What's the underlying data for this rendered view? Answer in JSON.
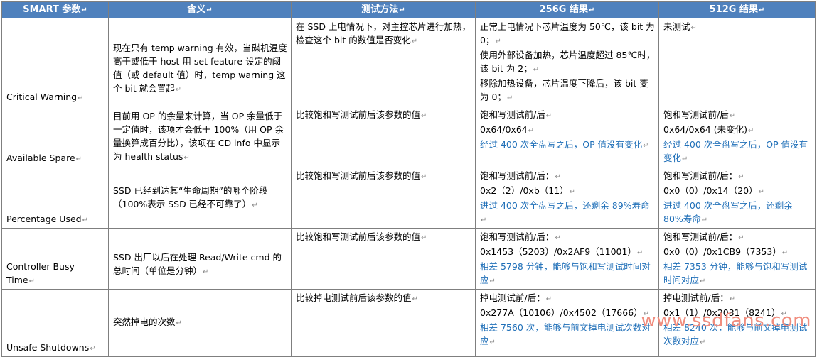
{
  "table": {
    "headers": [
      "SMART 参数",
      "含义",
      "测试方法",
      "256G 结果",
      "512G 结果"
    ],
    "rows": [
      {
        "param": "Critical Warning",
        "meaning": "现在只有 temp warning 有效，当碟机温度高于或低于 host 用 set feature 设定的阈值（或 default 值）时，temp warning 这个 bit 就会置起",
        "method": "在 SSD 上电情况下，对主控芯片进行加热，检查这个 bit 的数值是否变化",
        "r256": [
          "正常上电情况下芯片温度为 50℃，该 bit 为 0；",
          "使用外部设备加热，芯片温度超过 85℃时，该 bit 为 2；",
          "移除加热设备，芯片温度下降后，该 bit 变为 0；"
        ],
        "r256_note": "",
        "r512": [
          "未测试"
        ],
        "r512_note": ""
      },
      {
        "param": "Available Spare",
        "meaning": "目前用 OP 的余量来计算，当 OP 余量低于一定值时，该项才会低于 100%（用 OP 余量换算成百分比），该项在 CD info 中显示为 health status",
        "method": "比较饱和写测试前后该参数的值",
        "r256": [
          "饱和写测试前/后",
          "0x64/0x64"
        ],
        "r256_note": "经过 400 次全盘写之后，OP 值没有变化",
        "r512": [
          "饱和写测试前/后",
          "0x64/0x64 (未变化)"
        ],
        "r512_note": "经过 400 次全盘写之后，OP 值没有变化"
      },
      {
        "param": "Percentage Used",
        "meaning": "SSD 已经到达其“生命周期”的哪个阶段（100%表示 SSD 已经不可靠了）",
        "method": "比较饱和写测试前后该参数的值",
        "r256": [
          "饱和写测试前/后：",
          "0x2（2）/0xb（11）"
        ],
        "r256_note": "进过 400 次全盘写之后，还剩余 89%寿命",
        "r512": [
          "饱和写测试前/后：",
          "0x0（0）/0x14（20）"
        ],
        "r512_note": "进过 400 次全盘写之后，还剩余 80%寿命"
      },
      {
        "param": "Controller Busy Time",
        "meaning": "SSD 出厂以后在处理 Read/Write cmd 的总时间（单位是分钟）",
        "method": "比较饱和写测试前后该参数的值",
        "r256": [
          "饱和写测试前/后：",
          "0x1453（5203）/0x2AF9（11001）"
        ],
        "r256_note": "相差 5798 分钟，能够与饱和写测试时间对应",
        "r512": [
          "饱和写测试前/后：",
          "0x0（0）/0x1CB9（7353）"
        ],
        "r512_note": "相差 7353 分钟，能够与饱和写测试时间对应"
      },
      {
        "param": "Unsafe Shutdowns",
        "meaning": "突然掉电的次数",
        "method": "比较掉电测试前后该参数的值",
        "r256": [
          "掉电测试前/后：",
          "0x277A（10106）/0x4502（17666）"
        ],
        "r256_note": "相差 7560 次，能够与前文掉电测试次数对应",
        "r512": [
          "掉电测试前/后：",
          "0x1（1）/0x2031（8241）"
        ],
        "r512_note": "相差 8240 次，能够与前文掉电测试次数对应"
      }
    ]
  },
  "watermark": "www.ssdfans.com",
  "colors": {
    "header_bg": "#4f81bd",
    "note_blue": "#1f6fb8",
    "watermark": "#f08d7e"
  }
}
